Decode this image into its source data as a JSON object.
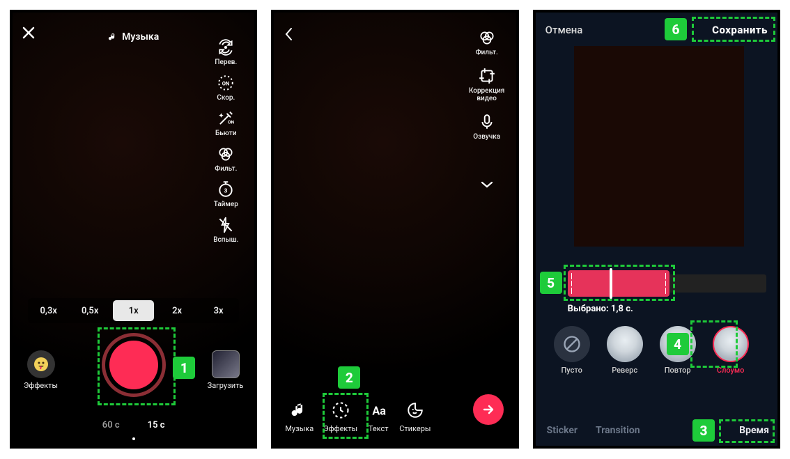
{
  "panel1": {
    "music_label": "Музыка",
    "rail": [
      {
        "label": "Перев."
      },
      {
        "label": "Скор."
      },
      {
        "label": "Бьюти"
      },
      {
        "label": "Фильт."
      },
      {
        "label": "Таймер"
      },
      {
        "label": "Вспыш."
      }
    ],
    "speeds": [
      "0,3x",
      "0,5x",
      "1x",
      "2x",
      "3x"
    ],
    "speed_active_index": 2,
    "effects_label": "Эффекты",
    "upload_label": "Загрузить",
    "durations": [
      "60 c",
      "15 c"
    ],
    "duration_active_index": 1
  },
  "panel2": {
    "rail": [
      {
        "label": "Фильт."
      },
      {
        "label": "Коррекция видео"
      },
      {
        "label": "Озвучка"
      }
    ],
    "bottom": [
      {
        "label": "Музыка"
      },
      {
        "label": "Эффекты"
      },
      {
        "label": "Текст"
      },
      {
        "label": "Стикеры"
      }
    ]
  },
  "panel3": {
    "cancel": "Отмена",
    "save": "Сохранить",
    "selected_label": "Выбрано: 1,8 с.",
    "effects": [
      {
        "label": "Пусто"
      },
      {
        "label": "Реверс"
      },
      {
        "label": "Повтор"
      },
      {
        "label": "Слоумо"
      }
    ],
    "active_effect_index": 3,
    "tabs": [
      "Sticker",
      "Transition",
      "Время"
    ],
    "active_tab_index": 2
  },
  "annotations": [
    "1",
    "2",
    "3",
    "4",
    "5",
    "6"
  ]
}
